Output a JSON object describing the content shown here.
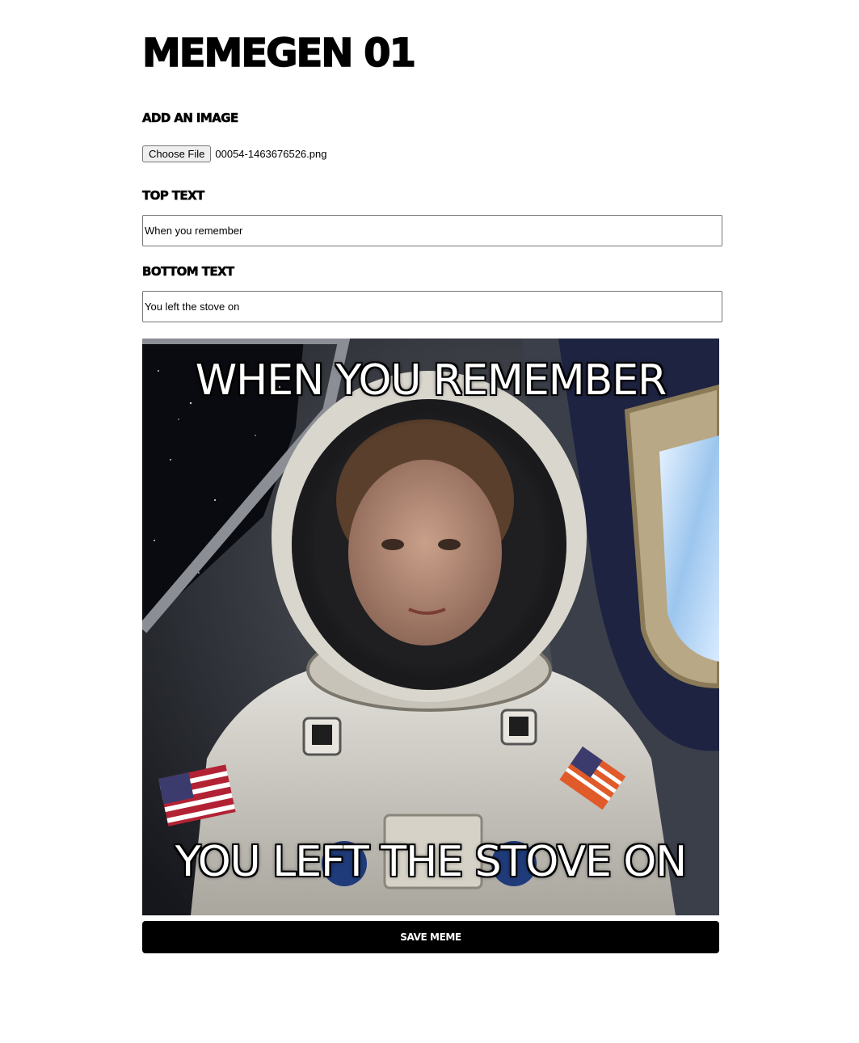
{
  "app": {
    "title": "MEMEGEN 01"
  },
  "image_section": {
    "label": "ADD AN IMAGE",
    "file_button_label": "Choose File",
    "file_name": "00054-1463676526.png"
  },
  "top_text": {
    "label": "TOP TEXT",
    "value": "When you remember"
  },
  "bottom_text": {
    "label": "BOTTOM TEXT",
    "value": "You left the stove on"
  },
  "meme": {
    "top_caption": "WHEN YOU REMEMBER",
    "bottom_caption": "YOU LEFT THE STOVE ON"
  },
  "save_button_label": "SAVE MEME"
}
